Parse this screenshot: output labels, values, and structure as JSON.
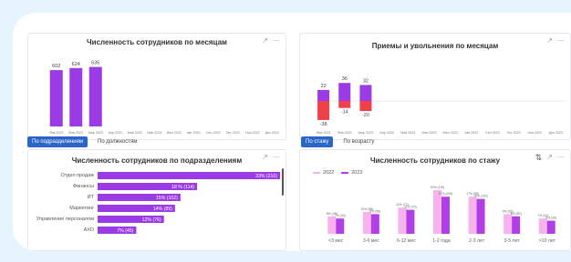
{
  "panels": {
    "monthly": {
      "title": "Численность сотрудников по месяцам",
      "chart_data": {
        "type": "bar",
        "categories": [
          "Янв 2023",
          "Фев 2023",
          "Мар 2023",
          "Апр 2023",
          "Май 2023",
          "Июн 2023",
          "Июл 2023",
          "Авг 2023",
          "Сен 2023",
          "Окт 2023",
          "Ноя 2023",
          "Дек 2023"
        ],
        "values": [
          602,
          624,
          636,
          null,
          null,
          null,
          null,
          null,
          null,
          null,
          null,
          null
        ],
        "color": "#9b3be6"
      }
    },
    "hires": {
      "title": "Приемы и увольнения по месяцам",
      "chart_data": {
        "type": "bar",
        "categories": [
          "Янв 2023",
          "Фев 2023",
          "Мар 2023",
          "Апр 2023",
          "Май 2023",
          "Июн 2023",
          "Июл 2023",
          "Авг 2023",
          "Сен 2023",
          "Окт 2023",
          "Ноя 2023",
          "Дек 2023"
        ],
        "series": [
          {
            "values": [
              22,
              36,
              32,
              null,
              null,
              null,
              null,
              null,
              null,
              null,
              null,
              null
            ],
            "color": "#9b3be6"
          },
          {
            "values": [
              -38,
              -14,
              -20,
              null,
              null,
              null,
              null,
              null,
              null,
              null,
              null,
              null
            ],
            "color": "#f0404a"
          }
        ]
      }
    },
    "departments": {
      "title": "Численность сотрудников по подразделениям",
      "tabs": [
        "По подразделениям",
        "По должностям"
      ],
      "chart_data": {
        "type": "bar",
        "orientation": "horizontal",
        "categories": [
          "Отдел продаж",
          "Финансы",
          "ИТ",
          "Маркетинг",
          "Управление персоналом",
          "АХО"
        ],
        "values": [
          33,
          18,
          15,
          14,
          12,
          7
        ],
        "labels": [
          "33% (210)",
          "18 % (114)",
          "15% (102)",
          "14% (89)",
          "12% (76)",
          "7% (45)"
        ],
        "color": "#9b3be6"
      }
    },
    "tenure": {
      "title": "Численность сотрудников по стажу",
      "tabs": [
        "По стажу",
        "По возрасту"
      ],
      "chart_data": {
        "type": "bar",
        "categories": [
          "<3 мес",
          "3-6 мес",
          "6-12 мес",
          "1-2 года",
          "2-3 лет",
          "3-5 лет",
          ">10 лет"
        ],
        "series": [
          {
            "name": "2022",
            "values": [
              8,
              10,
              12,
              20,
              17,
              9,
              7
            ],
            "labels": [
              "8% (45)",
              "10% (58)",
              "12% (72)",
              "20% (119)",
              "17% (98)",
              "9% (53)",
              "7% (41)"
            ],
            "color": "#f6b3ec"
          },
          {
            "name": "2023",
            "values": [
              7,
              9,
              11,
              17,
              16,
              8,
              6
            ],
            "labels": [
              "7% (43)",
              "9% (56)",
              "11% (70)",
              "17% (105)",
              "16% (102)",
              "8% (50)",
              "6% (39)"
            ],
            "color": "#b23ee6"
          }
        ]
      }
    }
  },
  "icons": {
    "export": "export-icon",
    "more": "more-icon",
    "sort": "sort-icon"
  }
}
